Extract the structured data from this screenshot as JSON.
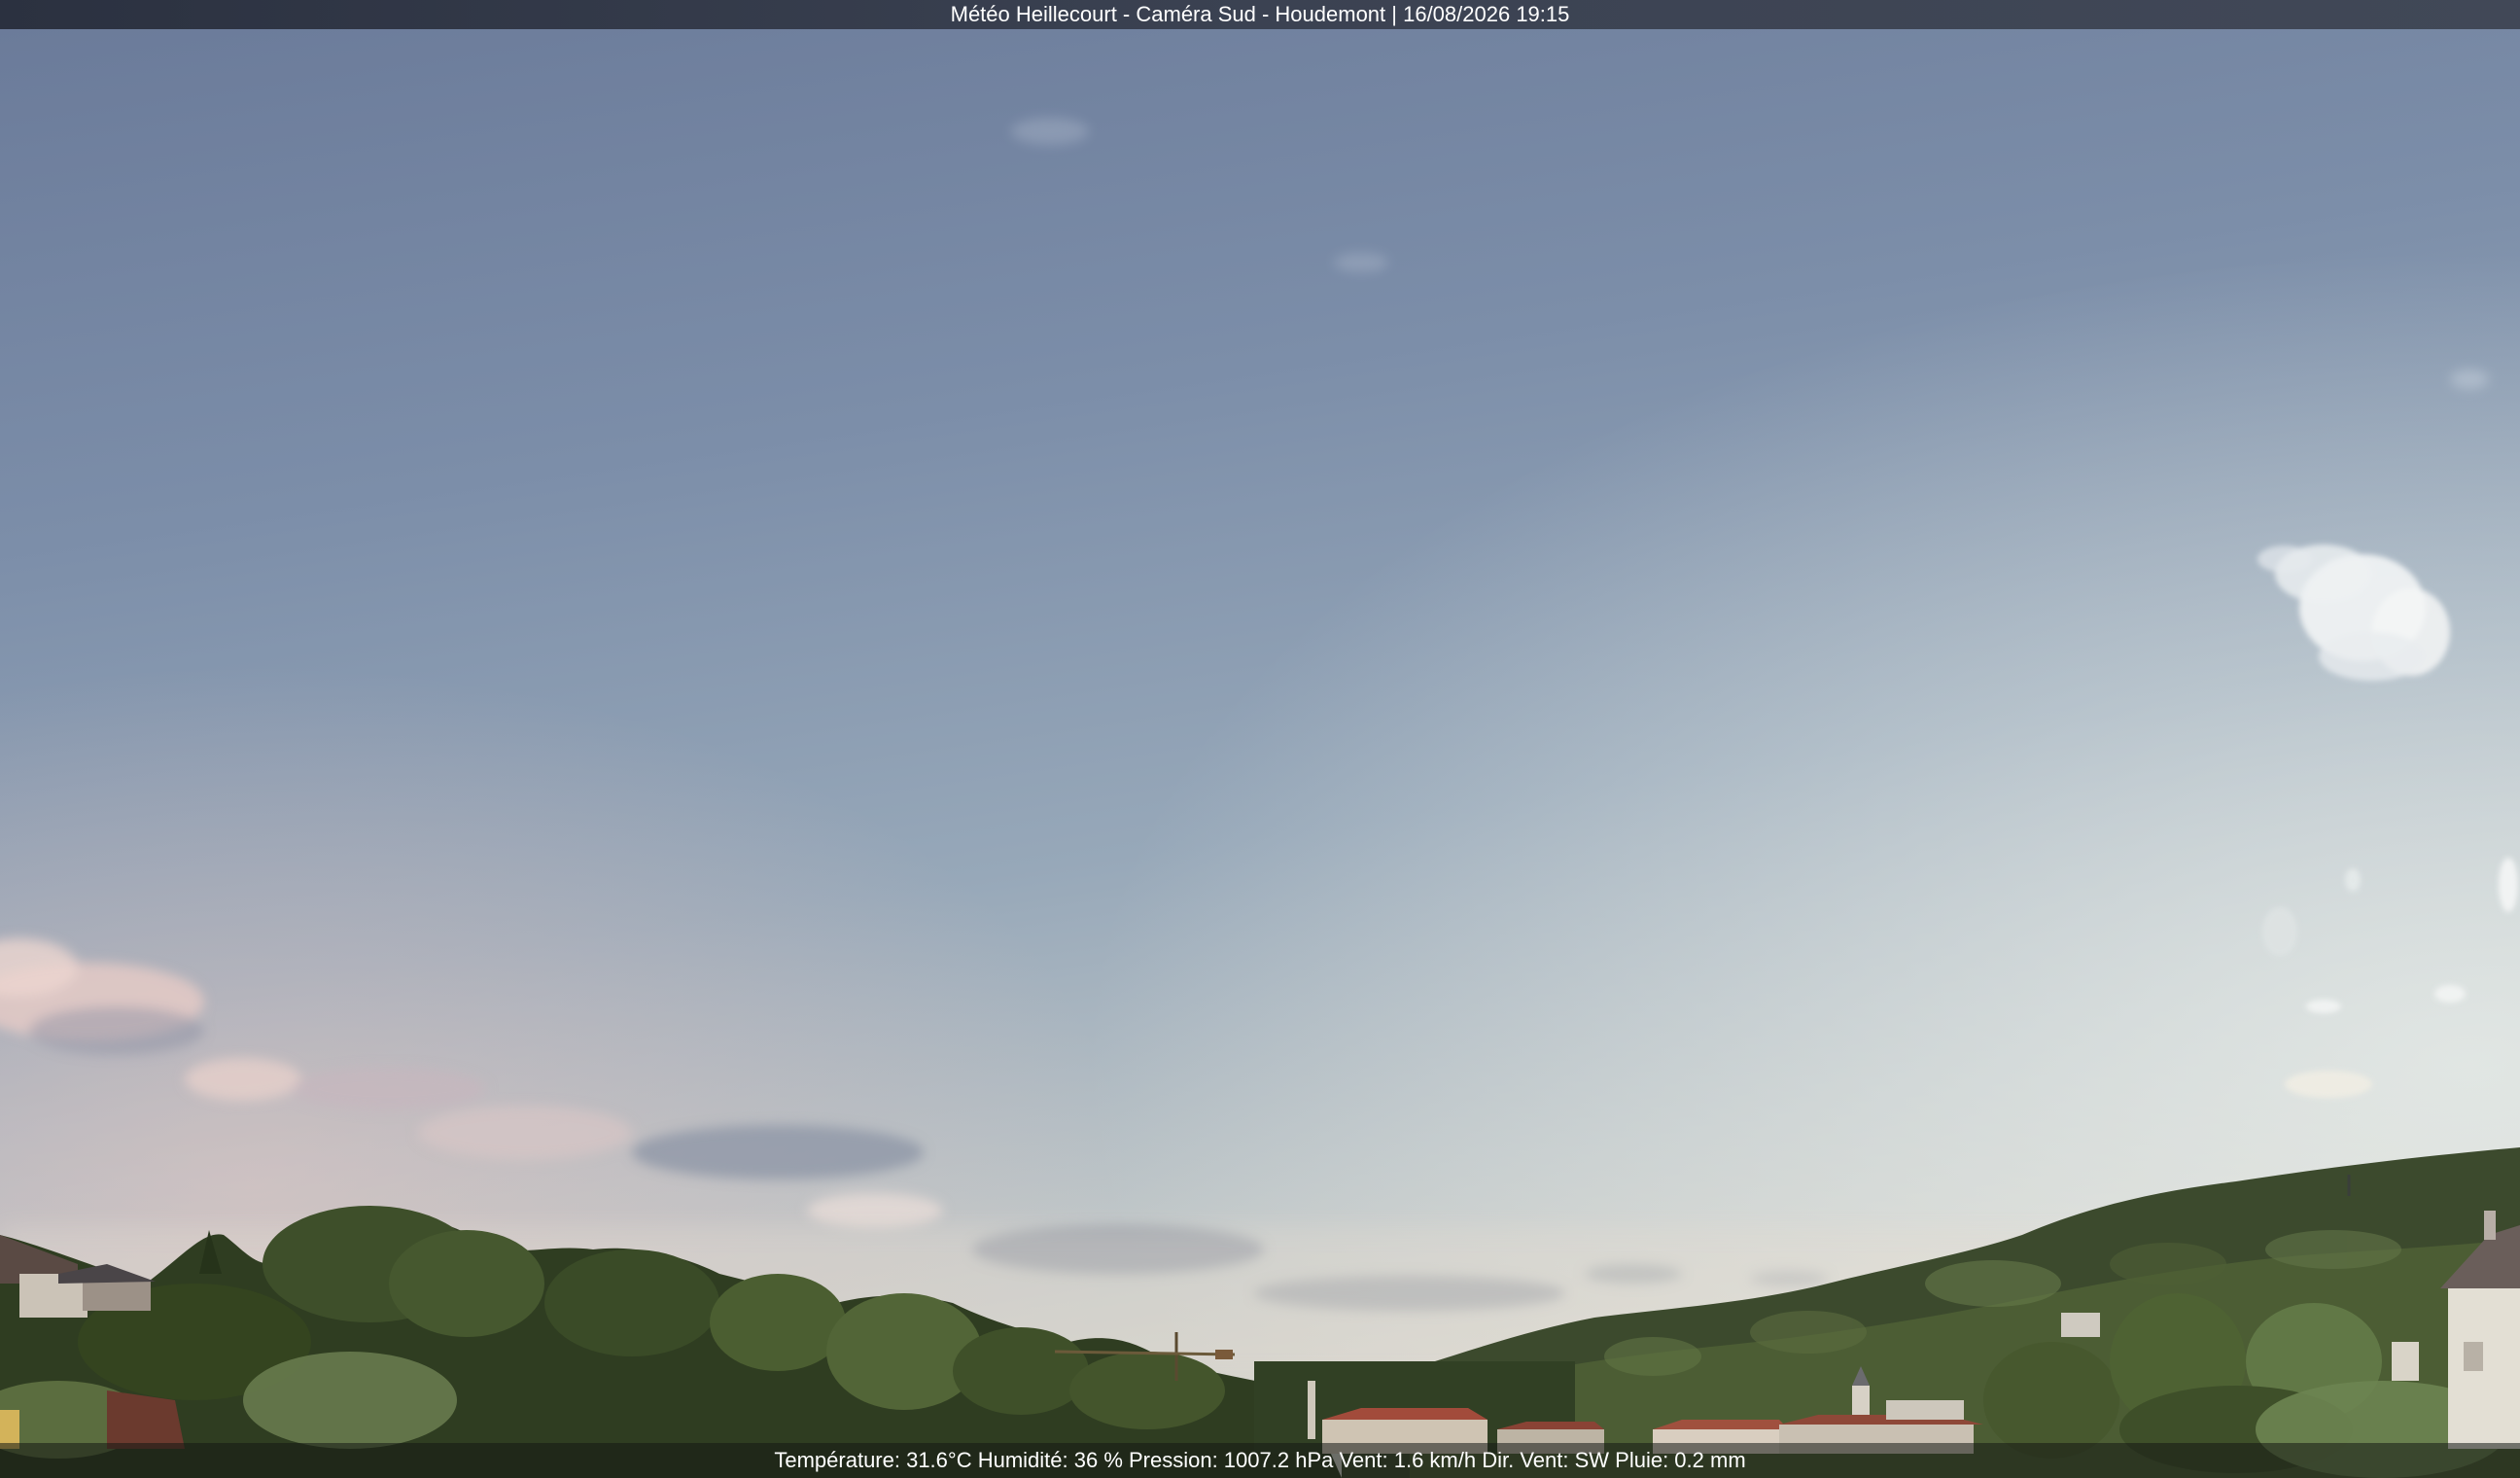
{
  "overlay": {
    "title": "Météo Heillecourt - Caméra Sud - Houdemont | 16/08/2026 19:15",
    "weather": "Température: 31.6°C  Humidité: 36 % Pression: 1007.2 hPa Vent: 1.6 km/h Dir. Vent: SW Pluie: 0.2 mm"
  },
  "colors": {
    "sky_top": "#6e7e9c",
    "sky_mid": "#8fa0b6",
    "sky_horizon": "#c9cfcf",
    "cloud_pink": "#e6cbc4",
    "cloud_grey": "#8a93a3",
    "foliage_dark": "#2f3d22",
    "foliage_light": "#5f7340",
    "roof_red": "#9c4b3a"
  },
  "icons": {
    "crane": "construction-crane-icon",
    "church": "church-steeple-icon"
  }
}
